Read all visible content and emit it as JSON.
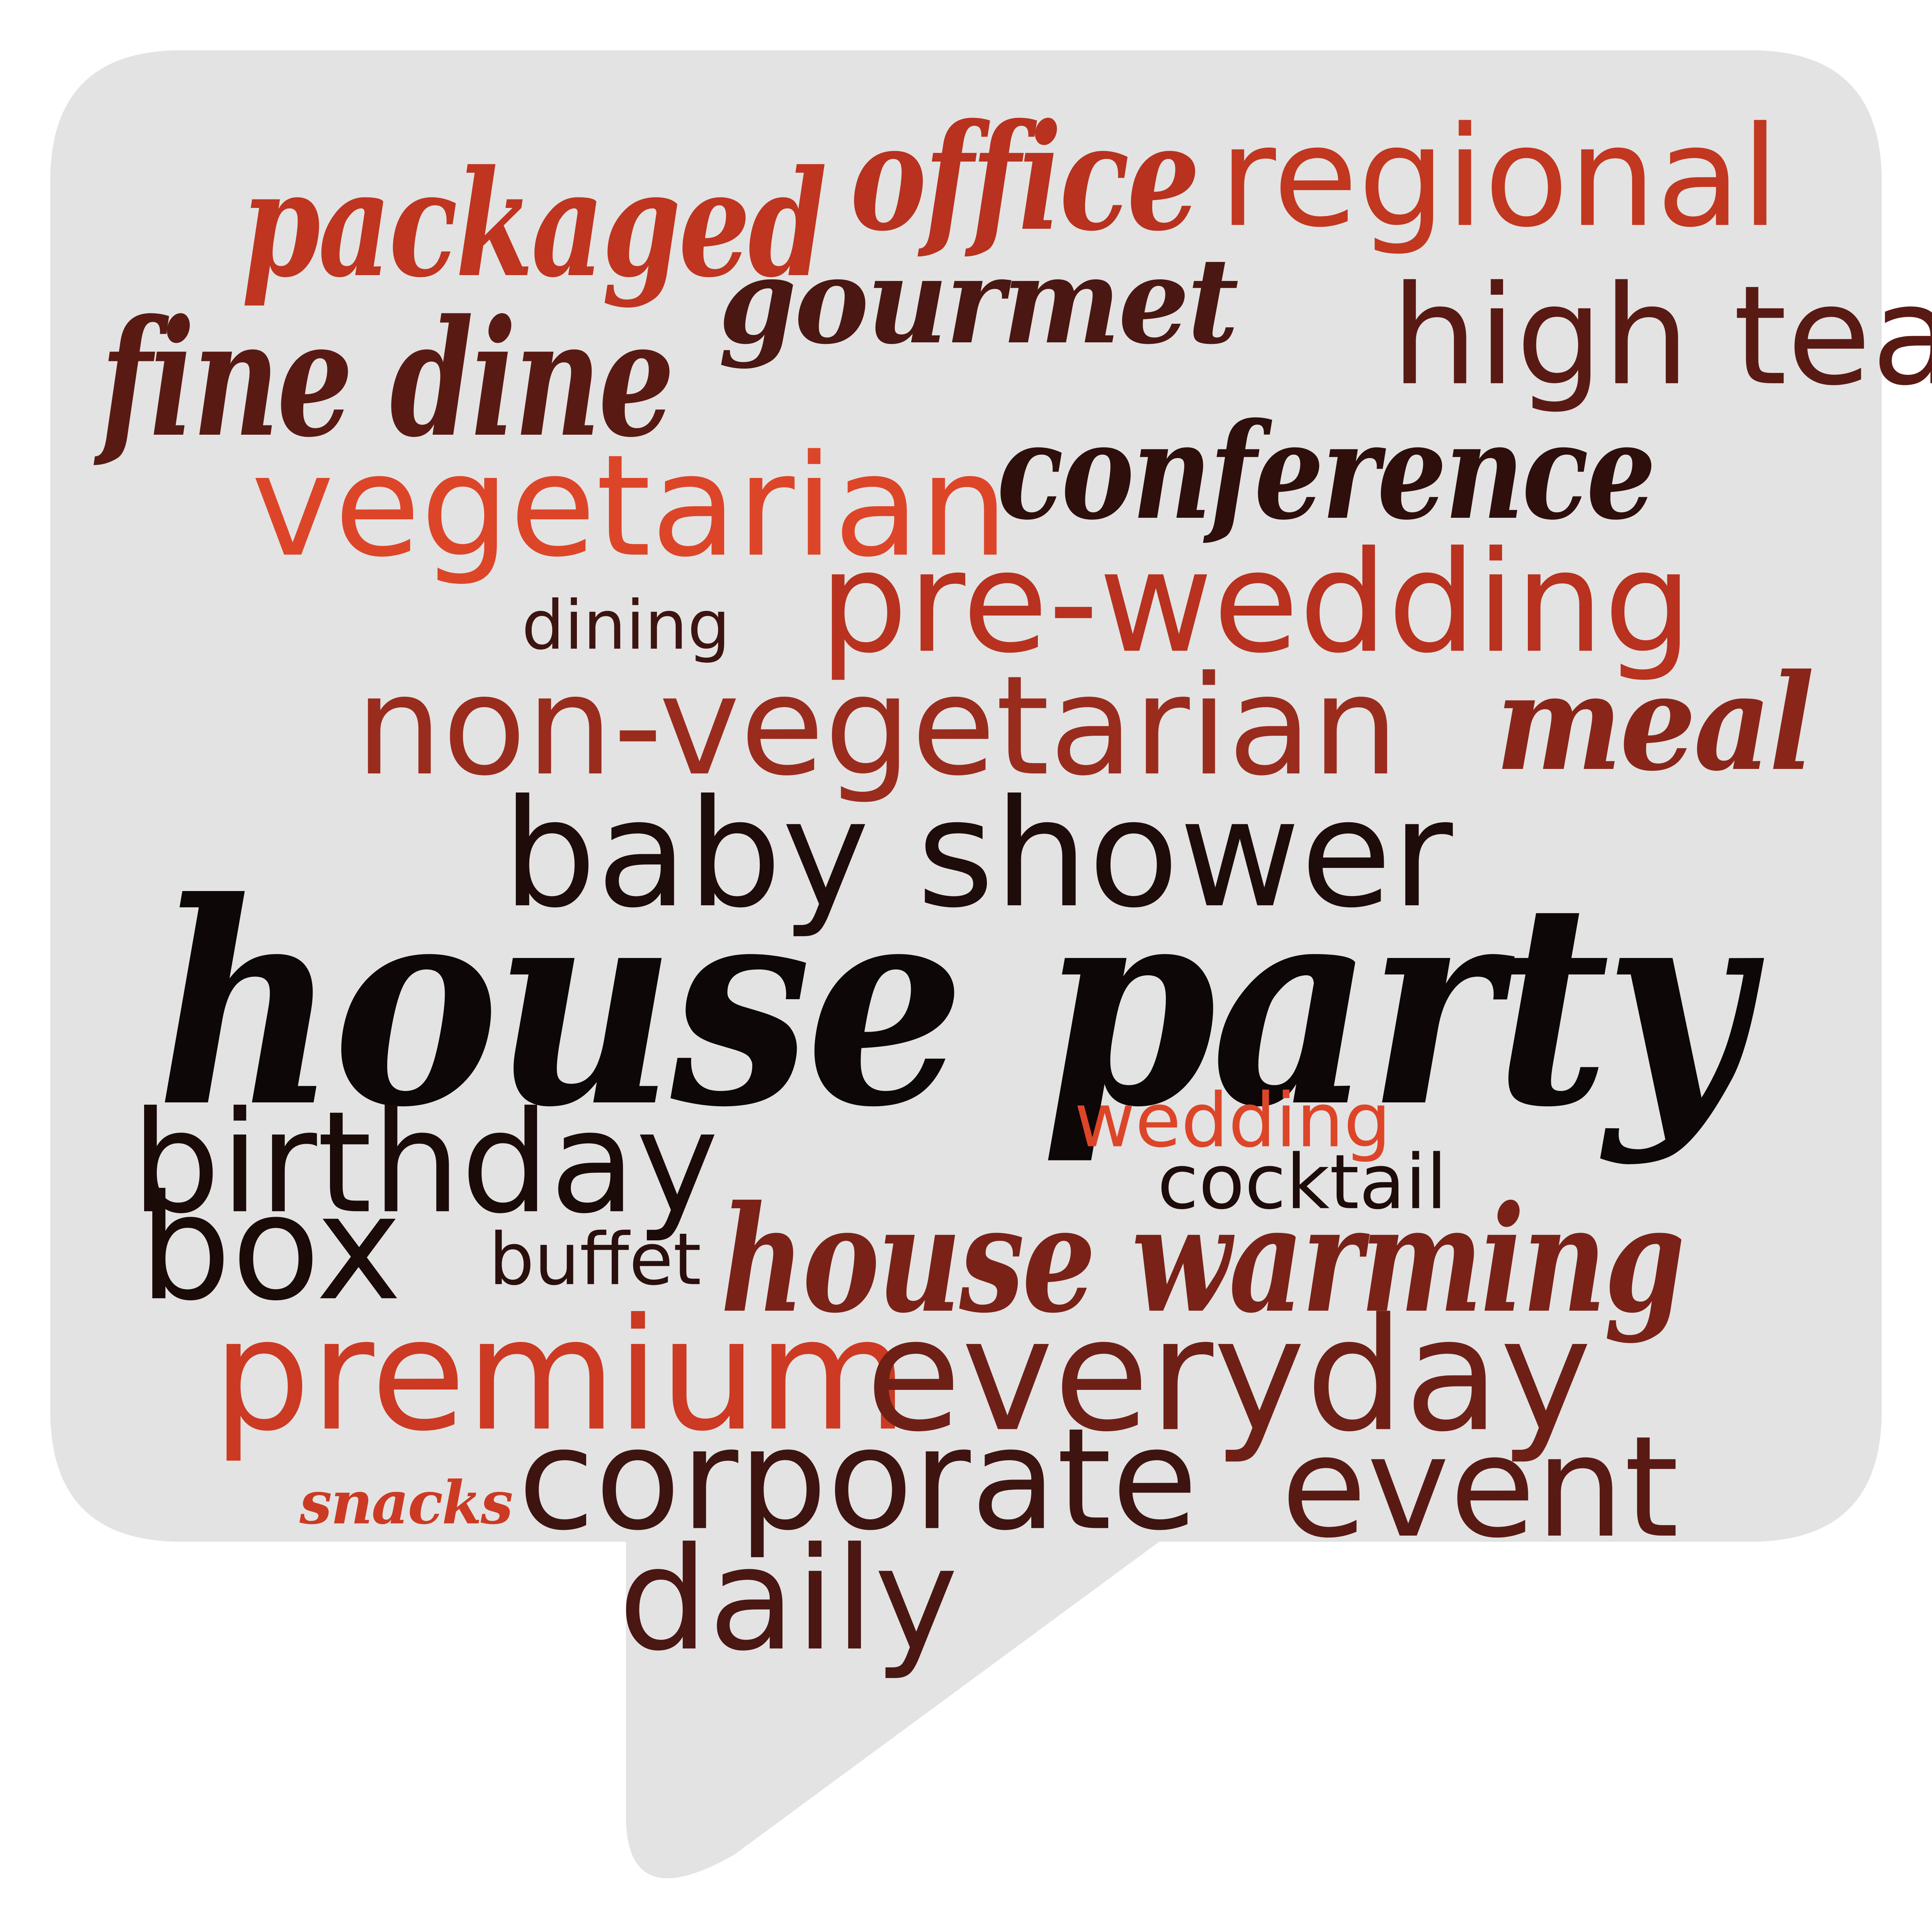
{
  "colors": {
    "bubble_fill": "#e3e3e3",
    "black": "#0d0707",
    "dark_brown": "#3e1410",
    "maroon": "#5a1a14",
    "brown_red": "#7a2218",
    "red_brown": "#9a2c1e",
    "red": "#b8321f",
    "bright_red": "#cc3a23",
    "orange_red": "#dd4529"
  },
  "word_cloud": {
    "words": [
      {
        "text": "packaged",
        "style": "script",
        "color": "#bf3520"
      },
      {
        "text": "office",
        "style": "script",
        "color": "#b8321f"
      },
      {
        "text": "regional",
        "style": "sans",
        "color": "#c23720"
      },
      {
        "text": "fine dine",
        "style": "script",
        "color": "#5a1a14"
      },
      {
        "text": "gourmet",
        "style": "script",
        "color": "#4a1712"
      },
      {
        "text": "high tea",
        "style": "sans",
        "color": "#5a1a14"
      },
      {
        "text": "vegetarian",
        "style": "sans",
        "color": "#dd4529"
      },
      {
        "text": "conference",
        "style": "script",
        "color": "#2e0f0c"
      },
      {
        "text": "dining",
        "style": "sans",
        "color": "#3e1410"
      },
      {
        "text": "pre-wedding",
        "style": "sans",
        "color": "#b8321f"
      },
      {
        "text": "non-vegetarian",
        "style": "sans",
        "color": "#9a2c1e"
      },
      {
        "text": "meal",
        "style": "script",
        "color": "#8a2619"
      },
      {
        "text": "baby shower",
        "style": "sans",
        "color": "#1e0c0a"
      },
      {
        "text": "house party",
        "style": "script",
        "color": "#0d0707"
      },
      {
        "text": "birthday",
        "style": "sans",
        "color": "#1a0b09"
      },
      {
        "text": "wedding",
        "style": "sans",
        "color": "#dd4529"
      },
      {
        "text": "cocktail",
        "style": "sans",
        "color": "#1e0c0a"
      },
      {
        "text": "box",
        "style": "sans",
        "color": "#1a0b09"
      },
      {
        "text": "buffet",
        "style": "sans",
        "color": "#2a0f0c"
      },
      {
        "text": "house warming",
        "style": "script",
        "color": "#7a2218"
      },
      {
        "text": "premium",
        "style": "sans",
        "color": "#cc3a23"
      },
      {
        "text": "everyday",
        "style": "sans",
        "color": "#6e2017"
      },
      {
        "text": "snacks",
        "style": "script",
        "color": "#cc3a23"
      },
      {
        "text": "corporate",
        "style": "sans",
        "color": "#3e1410"
      },
      {
        "text": "event",
        "style": "sans",
        "color": "#5a1a14"
      },
      {
        "text": "daily",
        "style": "sans",
        "color": "#4a1712"
      }
    ]
  }
}
